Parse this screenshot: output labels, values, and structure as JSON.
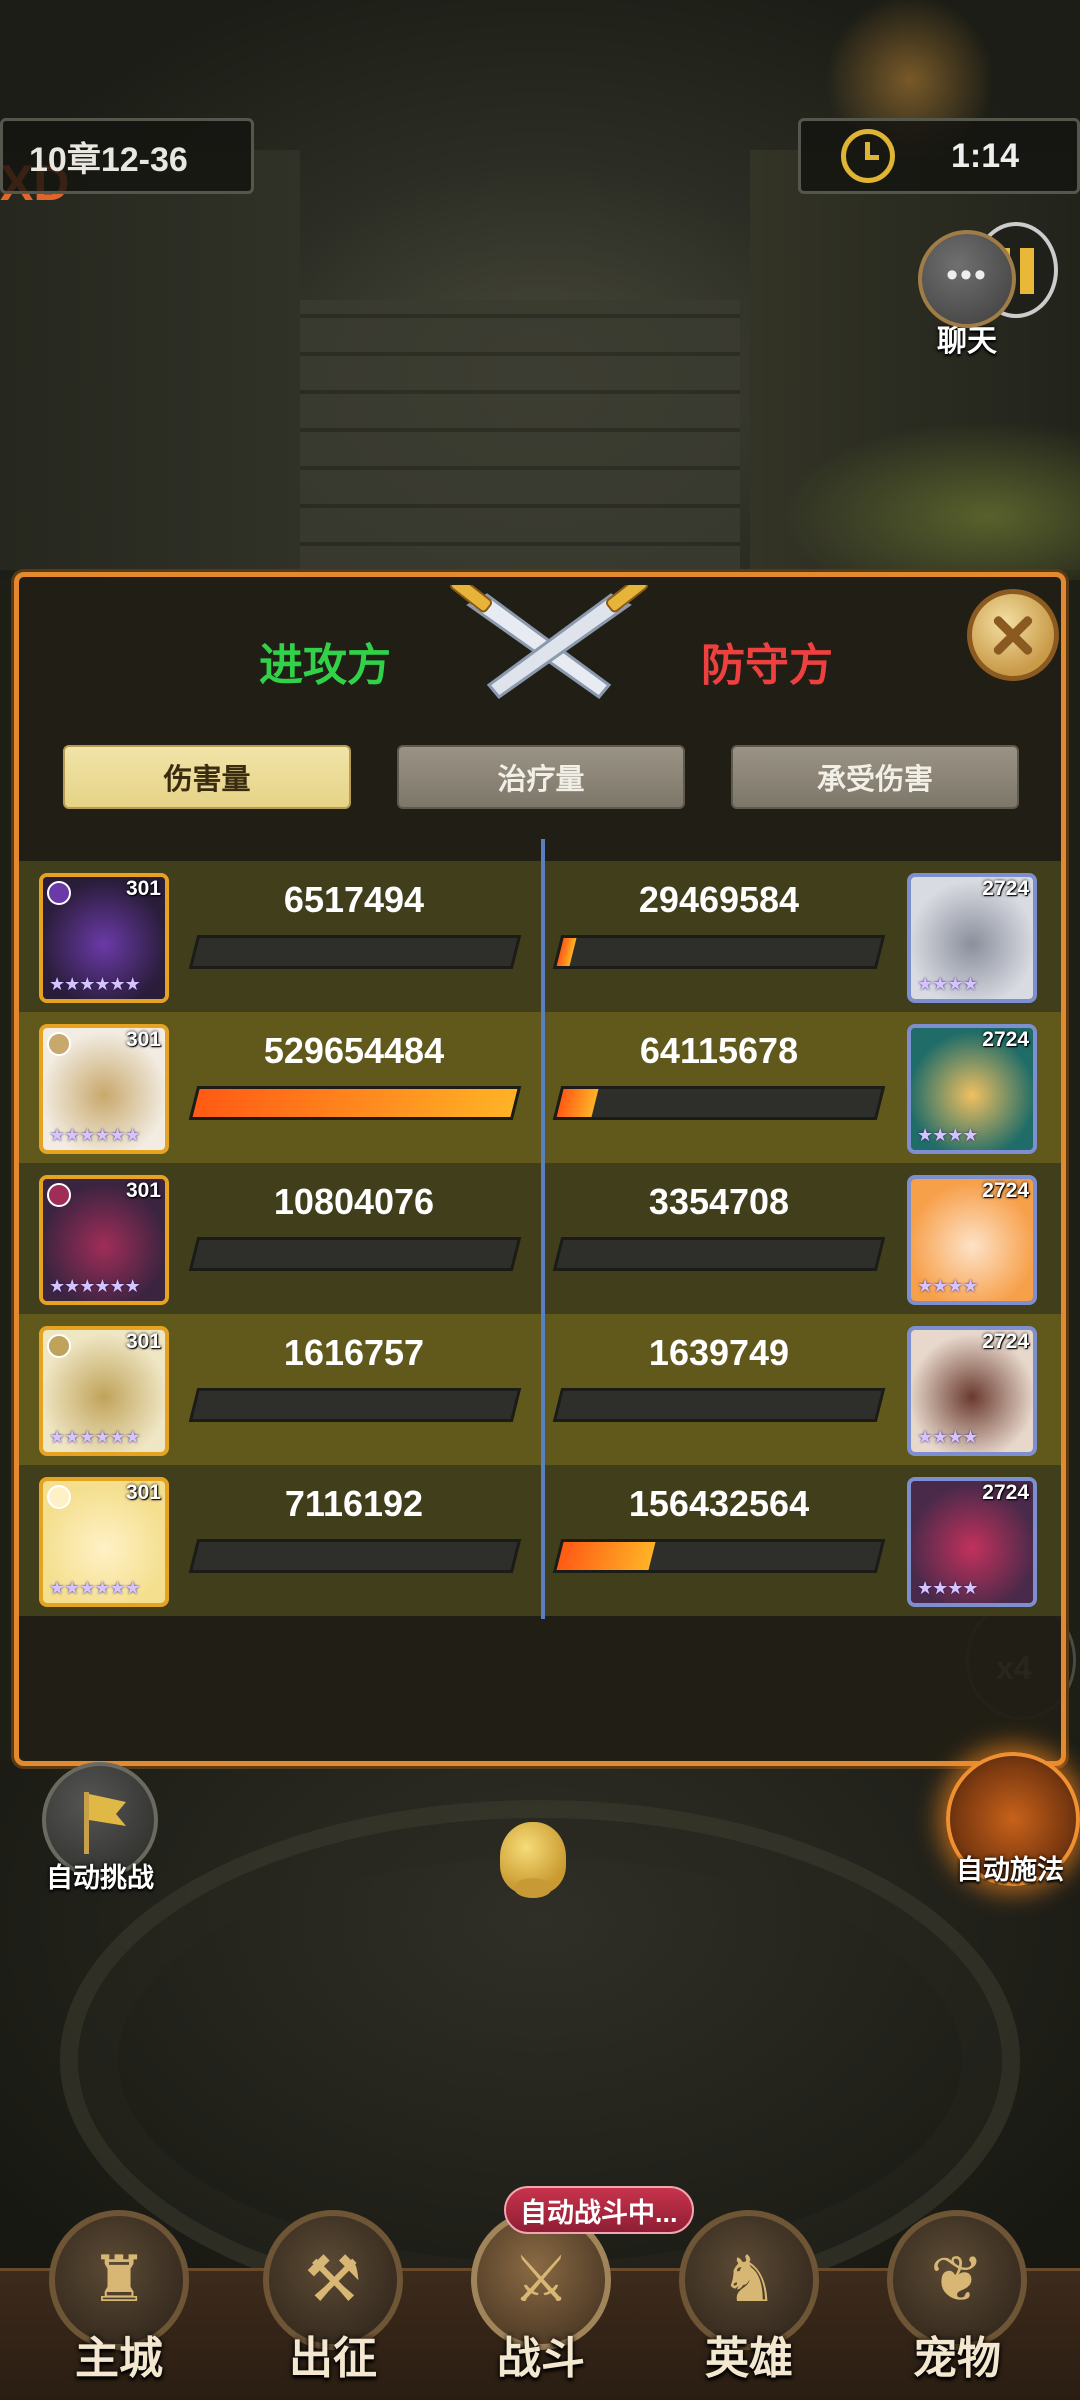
{
  "hud": {
    "stage": "10章12-36",
    "side_text": "XD",
    "timer": "1:14"
  },
  "chat": {
    "label": "聊天"
  },
  "panel": {
    "attacker_label": "进攻方",
    "defender_label": "防守方",
    "tabs": [
      {
        "label": "伤害量",
        "active": true
      },
      {
        "label": "治疗量",
        "active": false
      },
      {
        "label": "承受伤害",
        "active": false
      }
    ],
    "rows": [
      {
        "attacker": {
          "level": "301",
          "value": "6517494",
          "fill": 0.0,
          "portrait": "dark-knight"
        },
        "defender": {
          "level": "2724",
          "value": "29469584",
          "fill": 0.04,
          "portrait": "silver-hair"
        }
      },
      {
        "attacker": {
          "level": "301",
          "value": "529654484",
          "fill": 1.0,
          "portrait": "white-hair-girl"
        },
        "defender": {
          "level": "2724",
          "value": "64115678",
          "fill": 0.11,
          "portrait": "goggle-goblin"
        }
      },
      {
        "attacker": {
          "level": "301",
          "value": "10804076",
          "fill": 0.0,
          "portrait": "dark-elf"
        },
        "defender": {
          "level": "2724",
          "value": "3354708",
          "fill": 0.0,
          "portrait": "orange-hair"
        }
      },
      {
        "attacker": {
          "level": "301",
          "value": "1616757",
          "fill": 0.0,
          "portrait": "hooded-priestess"
        },
        "defender": {
          "level": "2724",
          "value": "1639749",
          "fill": 0.0,
          "portrait": "hat-girl"
        }
      },
      {
        "attacker": {
          "level": "301",
          "value": "7116192",
          "fill": 0.0,
          "portrait": "blonde-elf"
        },
        "defender": {
          "level": "2724",
          "value": "156432564",
          "fill": 0.29,
          "portrait": "dark-elf-2"
        }
      }
    ]
  },
  "buttons": {
    "auto_challenge": "自动挑战",
    "auto_cast": "自动施法",
    "speed": "x4"
  },
  "nav": {
    "badge": "自动战斗中...",
    "items": [
      {
        "label": "主城",
        "icon": "castle-icon"
      },
      {
        "label": "出征",
        "icon": "crossed-axes-icon"
      },
      {
        "label": "战斗",
        "icon": "shield-swords-icon"
      },
      {
        "label": "英雄",
        "icon": "hooded-hero-icon"
      },
      {
        "label": "宠物",
        "icon": "dragon-icon"
      }
    ]
  },
  "colors": {
    "attacker": "#31d24a",
    "defender": "#ef4040",
    "panel_border": "#e38a30",
    "bar_fill": "#ff7a1c"
  }
}
